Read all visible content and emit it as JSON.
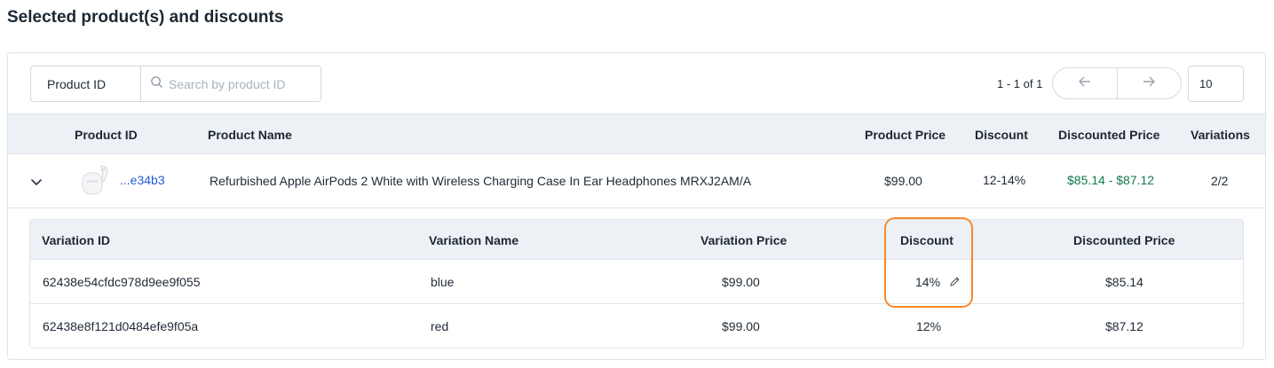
{
  "page": {
    "title": "Selected product(s) and discounts"
  },
  "toolbar": {
    "filter_field": "Product ID",
    "search_placeholder": "Search by product ID",
    "pagination_text": "1 - 1 of 1",
    "page_size": "10",
    "prev_icon": "arrow-left-icon",
    "next_icon": "arrow-right-icon"
  },
  "table": {
    "columns": [
      "Product ID",
      "Product Name",
      "Product Price",
      "Discount",
      "Discounted Price",
      "Variations"
    ],
    "rows": [
      {
        "product_id": "...e34b3",
        "product_name": "Refurbished Apple AirPods 2 White with Wireless Charging Case In Ear Headphones MRXJ2AM/A",
        "product_price": "$99.00",
        "discount": "12-14%",
        "discounted_price": "$85.14 - $87.12",
        "variations": "2/2"
      }
    ]
  },
  "variations": {
    "columns": [
      "Variation ID",
      "Variation Name",
      "Variation Price",
      "Discount",
      "Discounted Price"
    ],
    "rows": [
      {
        "id": "62438e54cfdc978d9ee9f055",
        "name": "blue",
        "price": "$99.00",
        "discount": "14%",
        "discounted_price": "$85.14"
      },
      {
        "id": "62438e8f121d0484efe9f05a",
        "name": "red",
        "price": "$99.00",
        "discount": "12%",
        "discounted_price": "$87.12"
      }
    ]
  },
  "colors": {
    "accent_link": "#1e5bd8",
    "discounted_price": "#117a4c",
    "highlight": "#f58b2a",
    "header_bg": "#edf1f5"
  }
}
